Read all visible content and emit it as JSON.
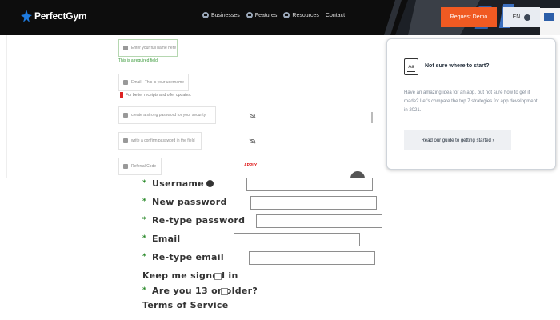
{
  "nav": {
    "logo_text": "PerfectGym",
    "links": [
      "Businesses",
      "Features",
      "Resources",
      "Contact"
    ],
    "request_demo": "Request Demo",
    "language": "EN"
  },
  "mockup": {
    "name_placeholder": "Enter your full name here",
    "required_note": "This is a required field.",
    "email_placeholder": "Email - This is your username",
    "offers_note": "For better receipts and offer updates.",
    "password_placeholder": "create a strong password for your security",
    "retype_placeholder": "write a confirm password in the field",
    "referral_placeholder": "Referral Code",
    "apply_label": "APPLY"
  },
  "card": {
    "icon_text": "Aa",
    "title": "Not sure where to start?",
    "body": "Have an amazing idea for an app, but not sure how to get it made? Let's compare the top 7 strategies for app development in 2021.",
    "button": "Read our guide to getting started ›"
  },
  "form": {
    "star": "*",
    "username_label": "Username",
    "new_password_label": "New password",
    "retype_password_label": "Re-type password",
    "email_label": "Email",
    "retype_email_label": "Re-type email",
    "keep_signed_label": "Keep me signed in",
    "age_label": "Are you 13 or older?",
    "terms_label": "Terms of Service"
  },
  "colors": {
    "nav_bg": "#0d0d0d",
    "accent": "#f05a22",
    "logo_blue": "#1e7be0",
    "required_star": "#2a8a2a"
  },
  "icons": [
    "logo-star-icon",
    "info-icon",
    "lock-icon",
    "user-icon",
    "eye-off-icon",
    "chevron-down-icon",
    "book-icon"
  ]
}
